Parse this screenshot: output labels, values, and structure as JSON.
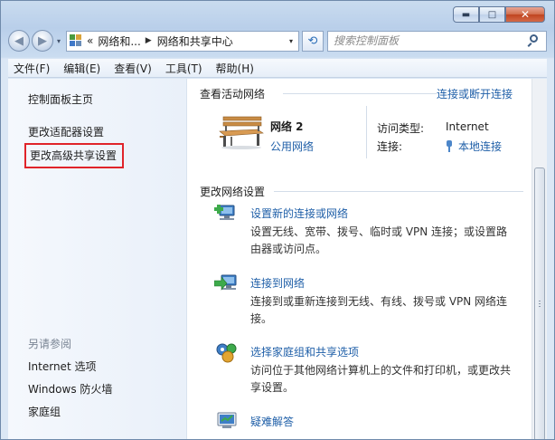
{
  "window": {
    "caption_buttons": [
      {
        "name": "minimize",
        "glyph": "▬"
      },
      {
        "name": "maximize",
        "glyph": "□"
      },
      {
        "name": "close",
        "glyph": "✕"
      }
    ]
  },
  "nav": {
    "back_glyph": "◀",
    "forward_glyph": "▶",
    "history_glyph": "▾",
    "address_glyph": "▾",
    "refresh_glyph": "⟲",
    "overflow": "«",
    "breadcrumbs": [
      {
        "label": "网络和...",
        "sep": "▶"
      },
      {
        "label": "网络和共享中心",
        "sep": ""
      }
    ],
    "search_placeholder": "搜索控制面板"
  },
  "menu": [
    "文件(F)",
    "编辑(E)",
    "查看(V)",
    "工具(T)",
    "帮助(H)"
  ],
  "left_pane": {
    "links": [
      "控制面板主页",
      "更改适配器设置",
      "更改高级共享设置"
    ],
    "see_also_title": "另请参阅",
    "see_also": [
      "Internet 选项",
      "Windows 防火墙",
      "家庭组"
    ]
  },
  "active_networks": {
    "heading": "查看活动网络",
    "connect_link": "连接或断开连接",
    "network_name": "网络  2",
    "network_type": "公用网络",
    "access_label": "访问类型:",
    "access_value": "Internet",
    "connection_label": "连接:",
    "connection_value": "本地连接"
  },
  "change_settings": {
    "heading": "更改网络设置",
    "tasks": [
      {
        "title": "设置新的连接或网络",
        "desc": "设置无线、宽带、拨号、临时或 VPN 连接；或设置路由器或访问点。",
        "icon": "new-connection-icon"
      },
      {
        "title": "连接到网络",
        "desc": "连接到或重新连接到无线、有线、拨号或 VPN 网络连接。",
        "icon": "connect-network-icon"
      },
      {
        "title": "选择家庭组和共享选项",
        "desc": "访问位于其他网络计算机上的文件和打印机，或更改共享设置。",
        "icon": "homegroup-icon"
      },
      {
        "title": "疑难解答",
        "desc": "",
        "icon": "troubleshoot-icon"
      }
    ]
  },
  "colors": {
    "link": "#1f5fa8",
    "highlight_border": "#e0242a",
    "close_button": "#c0441f"
  }
}
